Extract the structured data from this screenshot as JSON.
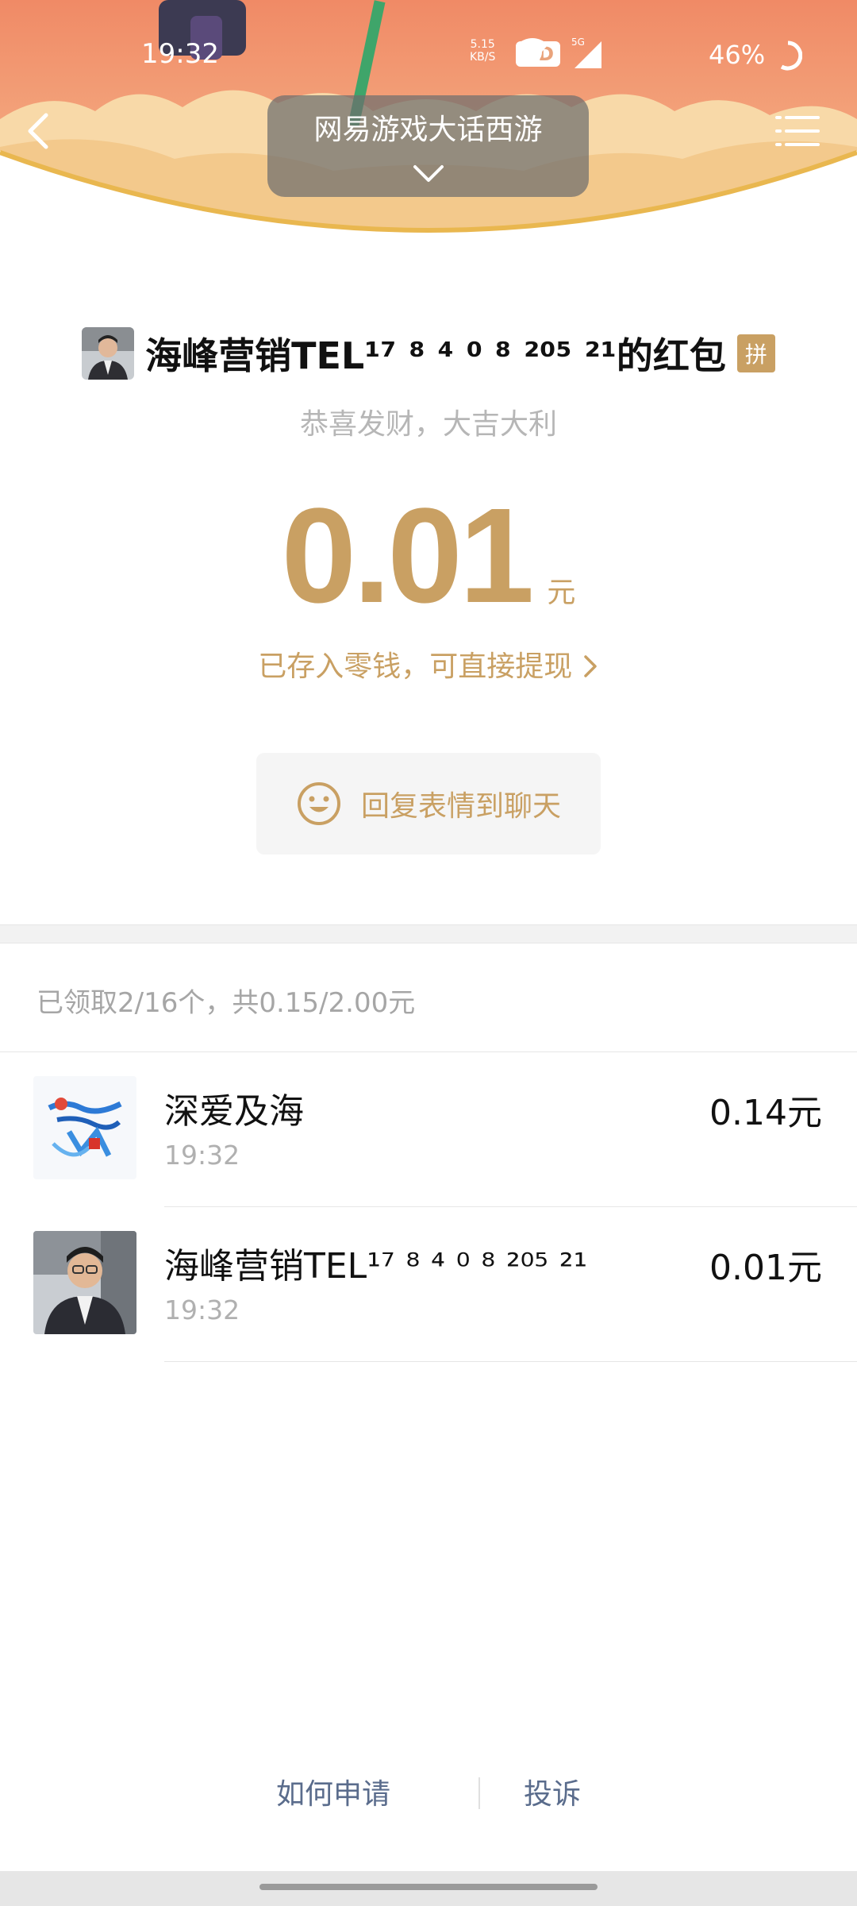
{
  "status_bar": {
    "time": "19:32",
    "net_speed": "5.15",
    "net_unit": "KB/S",
    "hd": "HD",
    "network": "5G",
    "battery": "46%"
  },
  "header": {
    "title": "网易游戏大话西游",
    "back_icon": "chevron-left-icon",
    "menu_icon": "list-menu-icon",
    "expand_icon": "chevron-down-icon"
  },
  "packet": {
    "sender_name": "海峰营销TEL¹⁷ ⁸ ⁴ ⁰ ⁸ ²⁰⁵ ²¹的红包",
    "type_badge": "拼",
    "blessing": "恭喜发财，大吉大利",
    "amount": "0.01",
    "unit": "元",
    "stored_text": "已存入零钱，可直接提现",
    "reply_label": "回复表情到聊天"
  },
  "summary": "已领取2/16个，共0.15/2.00元",
  "receivers": [
    {
      "name": "深爱及海",
      "time": "19:32",
      "amount": "0.14元"
    },
    {
      "name": "海峰营销TEL¹⁷ ⁸ ⁴ ⁰ ⁸ ²⁰⁵ ²¹",
      "time": "19:32",
      "amount": "0.01元"
    }
  ],
  "footer": {
    "how_to_apply": "如何申请",
    "complain": "投诉"
  },
  "colors": {
    "accent_gold": "#c9a063",
    "banner_orange": "#f3a37a",
    "link_blue": "#5a6c8c"
  }
}
